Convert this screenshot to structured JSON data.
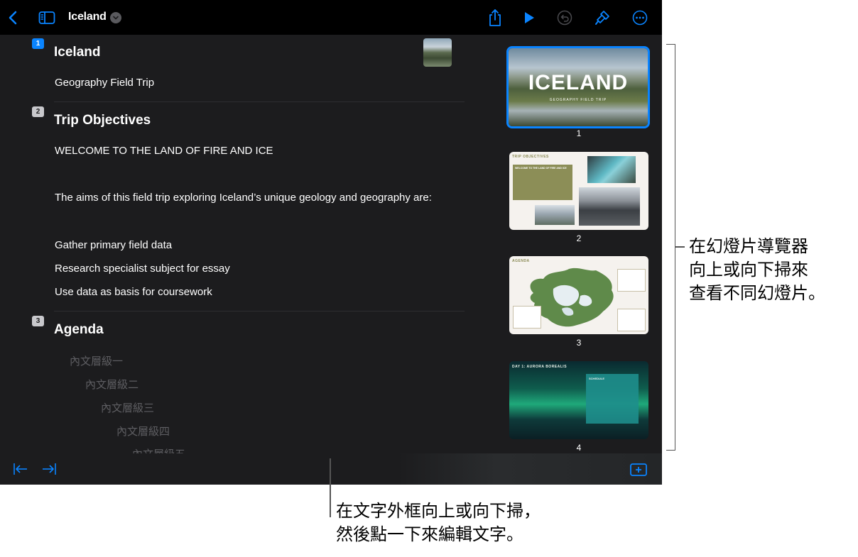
{
  "toolbar": {
    "title": "Iceland"
  },
  "outline": {
    "slides": [
      {
        "number": "1",
        "title": "Iceland",
        "body": [
          "Geography Field Trip"
        ]
      },
      {
        "number": "2",
        "title": "Trip Objectives",
        "body": [
          "WELCOME TO THE LAND OF FIRE AND ICE",
          "The aims of this field trip exploring Iceland’s unique geology and geography are:",
          "Gather primary field data",
          "Research specialist subject for essay",
          "Use data as basis for coursework"
        ]
      },
      {
        "number": "3",
        "title": "Agenda",
        "placeholders": [
          "內文層級一",
          "內文層級二",
          "內文層級三",
          "內文層級四",
          "內文層級五"
        ]
      }
    ]
  },
  "navigator": {
    "thumbnails": [
      {
        "number": "1",
        "big_title": "ICELAND",
        "subtitle": "GEOGRAPHY FIELD TRIP",
        "selected": true
      },
      {
        "number": "2",
        "heading": "TRIP OBJECTIVES",
        "box_title": "WELCOME TO THE LAND OF FIRE AND ICE"
      },
      {
        "number": "3",
        "heading": "AGENDA"
      },
      {
        "number": "4",
        "heading": "DAY 1: AURORA BOREALIS",
        "box_title": "SCHEDULE"
      }
    ]
  },
  "callouts": {
    "navigator": [
      "在幻燈片導覽器",
      "向上或向下掃來",
      "查看不同幻燈片。"
    ],
    "text": [
      "在文字外框向上或向下掃，",
      "然後點一下來編輯文字。"
    ]
  },
  "colors": {
    "accent": "#0a84ff",
    "background": "#1c1c1e",
    "toolbar": "#000000"
  },
  "icons": [
    "back-chevron-icon",
    "sidebar-icon",
    "share-icon",
    "play-icon",
    "undo-icon",
    "paintbrush-icon",
    "more-icon",
    "outdent-icon",
    "indent-icon",
    "add-slide-icon"
  ]
}
